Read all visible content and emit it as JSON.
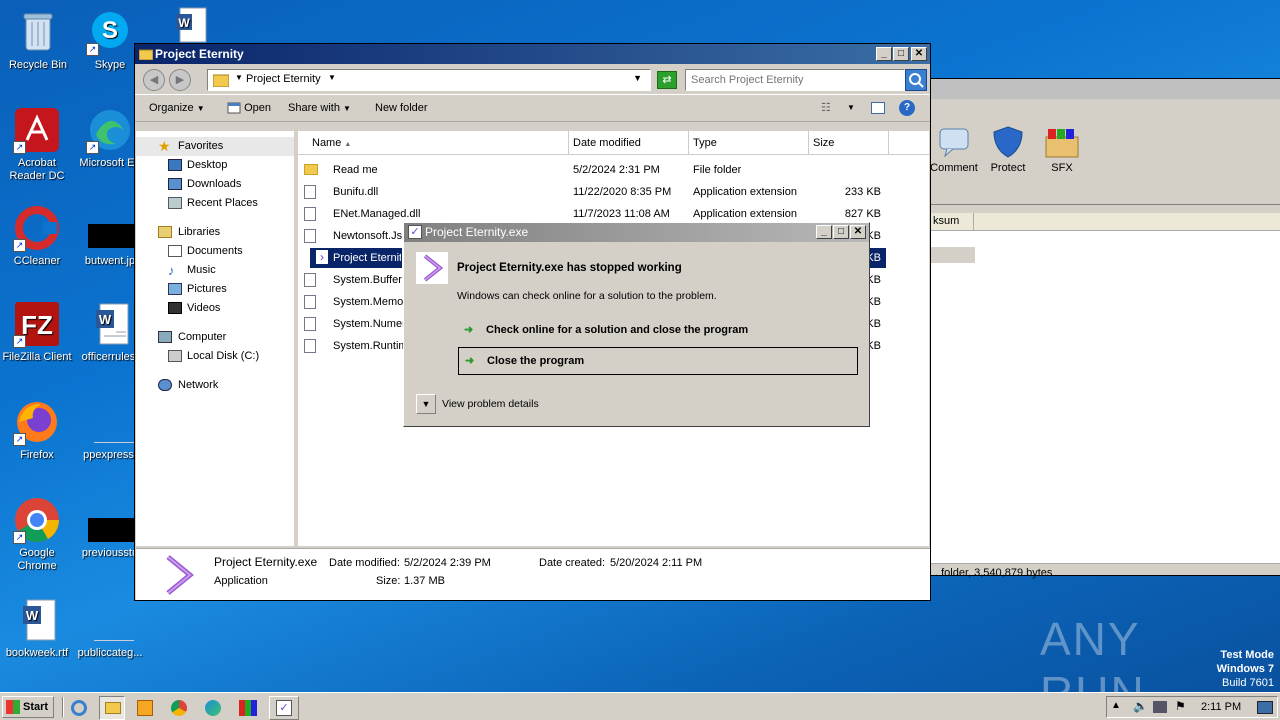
{
  "desktop": {
    "icons": [
      {
        "label": "Recycle Bin"
      },
      {
        "label": "Skype"
      },
      {
        "label": "Acrobat Reader DC"
      },
      {
        "label": "Microsoft Ed"
      },
      {
        "label": "CCleaner"
      },
      {
        "label": "butwent.jp"
      },
      {
        "label": "FileZilla Client"
      },
      {
        "label": "officerrules."
      },
      {
        "label": "Firefox"
      },
      {
        "label": "ppexpress."
      },
      {
        "label": "Google Chrome"
      },
      {
        "label": "previousstu"
      },
      {
        "label": "bookweek.rtf"
      },
      {
        "label": "publiccateg..."
      }
    ],
    "watermark": "ANY RUN",
    "testmode": {
      "line1": "Test Mode",
      "line2": "Windows 7",
      "line3": "Build 7601"
    }
  },
  "bg_window": {
    "toolbar": [
      {
        "label": "Comment"
      },
      {
        "label": "Protect"
      },
      {
        "label": "SFX"
      }
    ],
    "col_header": "ksum",
    "status": ". folder, 3,540,879 bytes"
  },
  "explorer": {
    "title": "Project Eternity",
    "address": "Project Eternity",
    "search_placeholder": "Search Project Eternity",
    "toolbar": {
      "organize": "Organize",
      "open": "Open",
      "share": "Share with",
      "new_folder": "New folder"
    },
    "nav": {
      "favorites": "Favorites",
      "fav_items": [
        "Desktop",
        "Downloads",
        "Recent Places"
      ],
      "libraries": "Libraries",
      "lib_items": [
        "Documents",
        "Music",
        "Pictures",
        "Videos"
      ],
      "computer": "Computer",
      "comp_items": [
        "Local Disk (C:)"
      ],
      "network": "Network"
    },
    "columns": {
      "name": "Name",
      "date": "Date modified",
      "type": "Type",
      "size": "Size"
    },
    "files": [
      {
        "name": "Read me",
        "date": "5/2/2024 2:31 PM",
        "type": "File folder",
        "size": ""
      },
      {
        "name": "Bunifu.dll",
        "date": "11/22/2020 8:35 PM",
        "type": "Application extension",
        "size": "233 KB"
      },
      {
        "name": "ENet.Managed.dll",
        "date": "11/7/2023 11:08 AM",
        "type": "Application extension",
        "size": "827 KB"
      },
      {
        "name": "Newtonsoft.Js",
        "date": "",
        "type": "",
        "size": "KB"
      },
      {
        "name": "Project Eternit",
        "date": "",
        "type": "",
        "size": "KB"
      },
      {
        "name": "System.Buffer",
        "date": "",
        "type": "",
        "size": "KB"
      },
      {
        "name": "System.Memor",
        "date": "",
        "type": "",
        "size": "KB"
      },
      {
        "name": "System.Numer",
        "date": "",
        "type": "",
        "size": "KB"
      },
      {
        "name": "System.Runtim",
        "date": "",
        "type": "",
        "size": "KB"
      }
    ],
    "details": {
      "name": "Project Eternity.exe",
      "kind": "Application",
      "modified_label": "Date modified:",
      "modified": "5/2/2024 2:39 PM",
      "created_label": "Date created:",
      "created": "5/20/2024 2:11 PM",
      "size_label": "Size:",
      "size": "1.37 MB"
    }
  },
  "dialog": {
    "title": "Project Eternity.exe",
    "heading": "Project Eternity.exe has stopped working",
    "message": "Windows can check online for a solution to the problem.",
    "option1": "Check online for a solution and close the program",
    "option2": "Close the program",
    "details": "View problem details"
  },
  "taskbar": {
    "start": "Start",
    "clock": "2:11 PM"
  }
}
